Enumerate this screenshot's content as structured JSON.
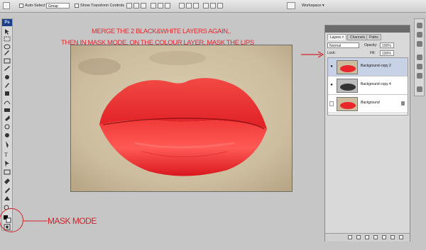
{
  "options_bar": {
    "auto_select_label": "Auto-Select:",
    "auto_select_value": "Group",
    "transform_controls_label": "Show Transform Controls",
    "workspace_label": "Workspace ▾"
  },
  "toolbox": {
    "logo": "Ps"
  },
  "annotations": {
    "line1": "MERGE THE 2 BLACK&WHITE LAYERS AGAIN,.",
    "line2": "THEN IN MASK MODE, ON THE COLOUR LAYER, MASK THE LIPS",
    "mask_mode": "MASK MODE",
    "arrow": "→"
  },
  "layers_panel": {
    "tabs": [
      "Layers ×",
      "Channels",
      "Paths"
    ],
    "blend_mode": "Normal",
    "opacity_label": "Opacity:",
    "opacity_value": "100%",
    "lock_label": "Lock:",
    "fill_label": "Fill:",
    "fill_value": "100%",
    "layers": [
      {
        "name": "Background copy 2",
        "visible": true,
        "selected": true,
        "style": "color"
      },
      {
        "name": "Background copy 4",
        "visible": true,
        "selected": false,
        "style": "bw"
      },
      {
        "name": "Background",
        "visible": false,
        "selected": false,
        "style": "color",
        "locked": true
      }
    ]
  },
  "colors": {
    "annotation": "#e8262b",
    "lips": "#f0282a",
    "skin": "#d2c2a4"
  }
}
